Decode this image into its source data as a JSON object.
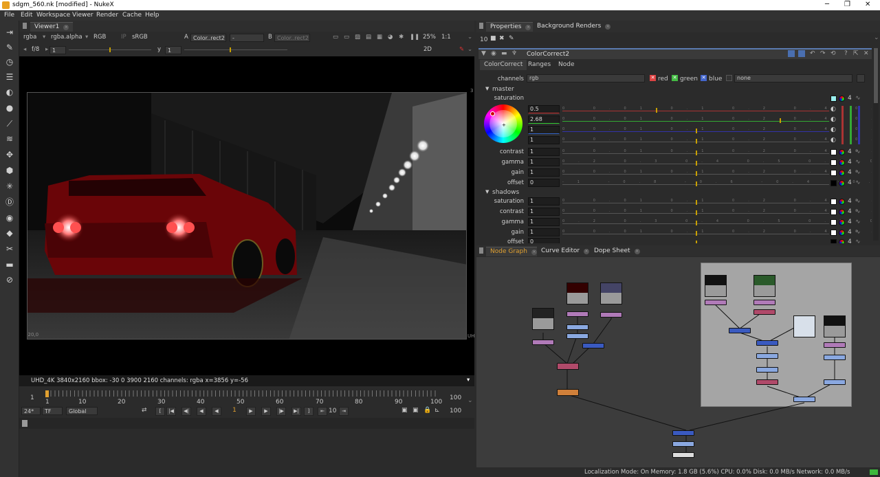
{
  "window": {
    "title": "sdgm_560.nk [modified] - NukeX"
  },
  "menubar": {
    "items": [
      "File",
      "Edit",
      "Workspace",
      "Viewer",
      "Render",
      "Cache",
      "Help"
    ]
  },
  "toolbar": {
    "icons": [
      "viewer-icon",
      "paint-icon",
      "time-icon",
      "channel-icon",
      "color-icon",
      "filter-icon",
      "keyer-icon",
      "merge-icon",
      "transform-icon",
      "3d-icon",
      "particles-icon",
      "deep-icon",
      "views-icon",
      "metadata-icon",
      "toolsets-icon",
      "other-icon",
      "furnace-icon"
    ]
  },
  "viewer": {
    "tab": "Viewer1",
    "channels": "rgba",
    "alpha": "rgba.alpha",
    "mode": "RGB",
    "ip": "IP",
    "lut": "sRGB",
    "inputA_label": "A",
    "inputA": "Color..rect2",
    "inputA2": "-",
    "inputB_label": "B",
    "inputB": "Color..rect2",
    "zoom": "25%",
    "ratio": "1:1",
    "fstop": "f/8",
    "frame": "1",
    "y_label": "y",
    "y_value": "1",
    "view_mode": "2D",
    "corner_bl": "-20,0",
    "corner_tr": "3",
    "corner_r": "UH",
    "info": "UHD_4K 3840x2160  bbox: -30 0 3900 2160 channels: rgba  x=3856 y=-56"
  },
  "timeline": {
    "start": "1",
    "end": "100",
    "ticks": [
      "1",
      "10",
      "20",
      "30",
      "40",
      "50",
      "60",
      "70",
      "80",
      "90",
      "100"
    ],
    "fps": "24*",
    "tf": "TF",
    "range": "Global",
    "current_frame": "1",
    "step": "10",
    "end_frame": "100"
  },
  "properties": {
    "tabs": [
      "Properties",
      "Background Renders"
    ],
    "count": "10",
    "node_name": "ColorCorrect2",
    "subtabs": [
      "ColorCorrect",
      "Ranges",
      "Node"
    ],
    "channels_label": "channels",
    "channels_value": "rgb",
    "red": "red",
    "green": "green",
    "blue": "blue",
    "none": "none",
    "master_section": "master",
    "master": {
      "saturation_label": "saturation",
      "saturation_values": [
        "0.5",
        "2.68",
        "1",
        "1"
      ],
      "contrast_label": "contrast",
      "contrast": "1",
      "gamma_label": "gamma",
      "gamma": "1",
      "gain_label": "gain",
      "gain": "1",
      "offset_label": "offset",
      "offset": "0"
    },
    "shadows_section": "shadows",
    "shadows": {
      "saturation_label": "saturation",
      "saturation": "1",
      "contrast_label": "contrast",
      "contrast": "1",
      "gamma_label": "gamma",
      "gamma": "1",
      "gain_label": "gain",
      "gain": "1",
      "offset_label": "offset",
      "offset": "0"
    },
    "button_4": "4"
  },
  "nodegraph": {
    "tabs": [
      "Node Graph",
      "Curve Editor",
      "Dope Sheet"
    ]
  },
  "status": "Localization Mode: On Memory: 1.8 GB (5.6%) CPU: 0.0% Disk: 0.0 MB/s Network: 0.0 MB/s"
}
